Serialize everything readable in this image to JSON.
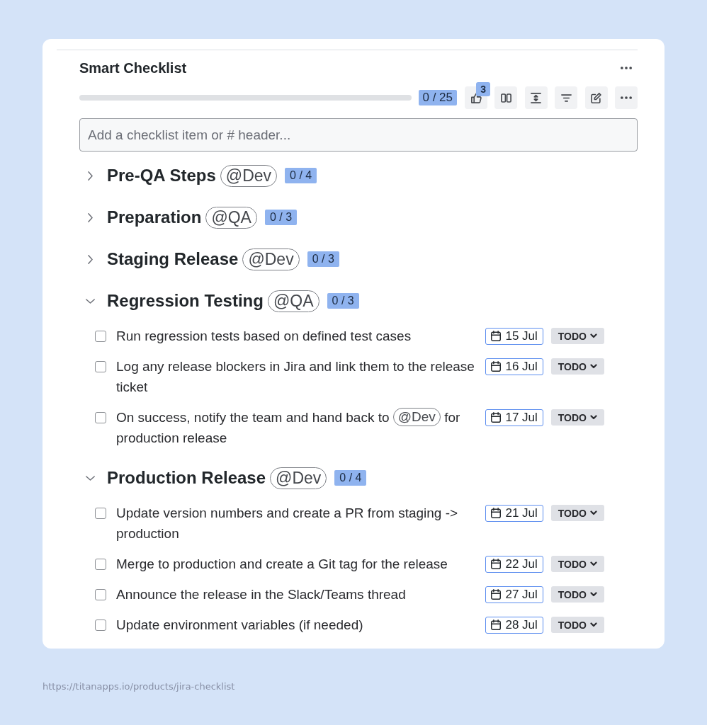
{
  "card": {
    "title": "Smart Checklist"
  },
  "progress": {
    "count": "0 / 25"
  },
  "toolbar": [
    {
      "kind": "thumbs-up",
      "badge": "3"
    },
    {
      "kind": "columns"
    },
    {
      "kind": "expand"
    },
    {
      "kind": "filter"
    },
    {
      "kind": "edit"
    },
    {
      "kind": "more"
    }
  ],
  "input": {
    "placeholder": "Add a checklist item or # header..."
  },
  "sections": [
    {
      "title": "Pre-QA Steps",
      "mention": "@Dev",
      "count": "0 / 4",
      "expanded": false
    },
    {
      "title": "Preparation",
      "mention": "@QA",
      "count": "0 / 3",
      "expanded": false
    },
    {
      "title": "Staging Release",
      "mention": "@Dev",
      "count": "0 / 3",
      "expanded": false
    },
    {
      "title": "Regression Testing",
      "mention": "@QA",
      "count": "0 / 3",
      "expanded": true,
      "items": [
        {
          "checked": false,
          "parts": [
            {
              "kind": "text",
              "text": "Run regression tests based on defined test cases"
            }
          ],
          "due": "15 Jul",
          "status": "TODO"
        },
        {
          "checked": false,
          "parts": [
            {
              "kind": "text",
              "text": "Log any release blockers in Jira and link them to the release ticket"
            }
          ],
          "due": "16 Jul",
          "status": "TODO"
        },
        {
          "checked": false,
          "parts": [
            {
              "kind": "text",
              "text": "On success, notify the team and hand back to "
            },
            {
              "kind": "mention",
              "text": "@Dev"
            },
            {
              "kind": "text",
              "text": " for production release"
            }
          ],
          "due": "17 Jul",
          "status": "TODO"
        }
      ]
    },
    {
      "title": "Production Release",
      "mention": "@Dev",
      "count": "0 / 4",
      "expanded": true,
      "items": [
        {
          "checked": false,
          "parts": [
            {
              "kind": "text",
              "text": "Update version numbers and create a PR from staging -> production"
            }
          ],
          "due": "21 Jul",
          "status": "TODO"
        },
        {
          "checked": false,
          "parts": [
            {
              "kind": "text",
              "text": "Merge to production and create a Git tag for the release"
            }
          ],
          "due": "22 Jul",
          "status": "TODO"
        },
        {
          "checked": false,
          "parts": [
            {
              "kind": "text",
              "text": "Announce the release in the Slack/Teams thread"
            }
          ],
          "due": "27 Jul",
          "status": "TODO"
        },
        {
          "checked": false,
          "parts": [
            {
              "kind": "text",
              "text": "Update environment variables (if needed)"
            }
          ],
          "due": "28 Jul",
          "status": "TODO"
        }
      ]
    }
  ],
  "caption": "https://titanapps.io/products/jira-checklist"
}
